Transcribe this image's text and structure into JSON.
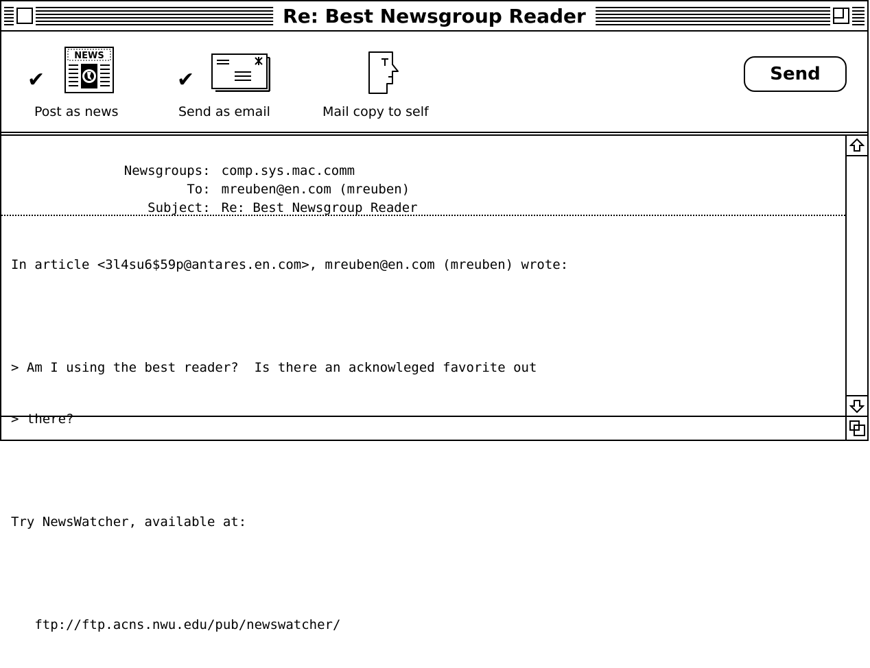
{
  "window": {
    "title": "Re: Best Newsgroup Reader"
  },
  "toolbar": {
    "post_news": {
      "label": "Post as news",
      "checked": true,
      "icon": "newspaper-icon",
      "icon_text": "NEWS"
    },
    "send_email": {
      "label": "Send as email",
      "checked": true,
      "icon": "envelope-icon"
    },
    "mail_self": {
      "label": "Mail copy to self",
      "checked": false,
      "icon": "face-icon"
    },
    "send_label": "Send",
    "check_glyph": "✔"
  },
  "headers": {
    "newsgroups": {
      "label": "Newsgroups:",
      "value": "comp.sys.mac.comm"
    },
    "to": {
      "label": "To:",
      "value": "mreuben@en.com (mreuben)"
    },
    "subject": {
      "label": "Subject:",
      "value": "Re: Best Newsgroup Reader"
    }
  },
  "body": {
    "lines": [
      "In article <3l4su6$59p@antares.en.com>, mreuben@en.com (mreuben) wrote:",
      "",
      "> Am I using the best reader?  Is there an acknowleged favorite out",
      "> there?",
      "",
      "Try NewsWatcher, available at:",
      "",
      "   ftp://ftp.acns.nwu.edu/pub/newswatcher/"
    ]
  },
  "icons": {
    "close": "close-box-icon",
    "zoom": "zoom-box-icon",
    "scroll_up": "arrow-up-icon",
    "scroll_down": "arrow-down-icon",
    "grow": "grow-box-icon"
  }
}
